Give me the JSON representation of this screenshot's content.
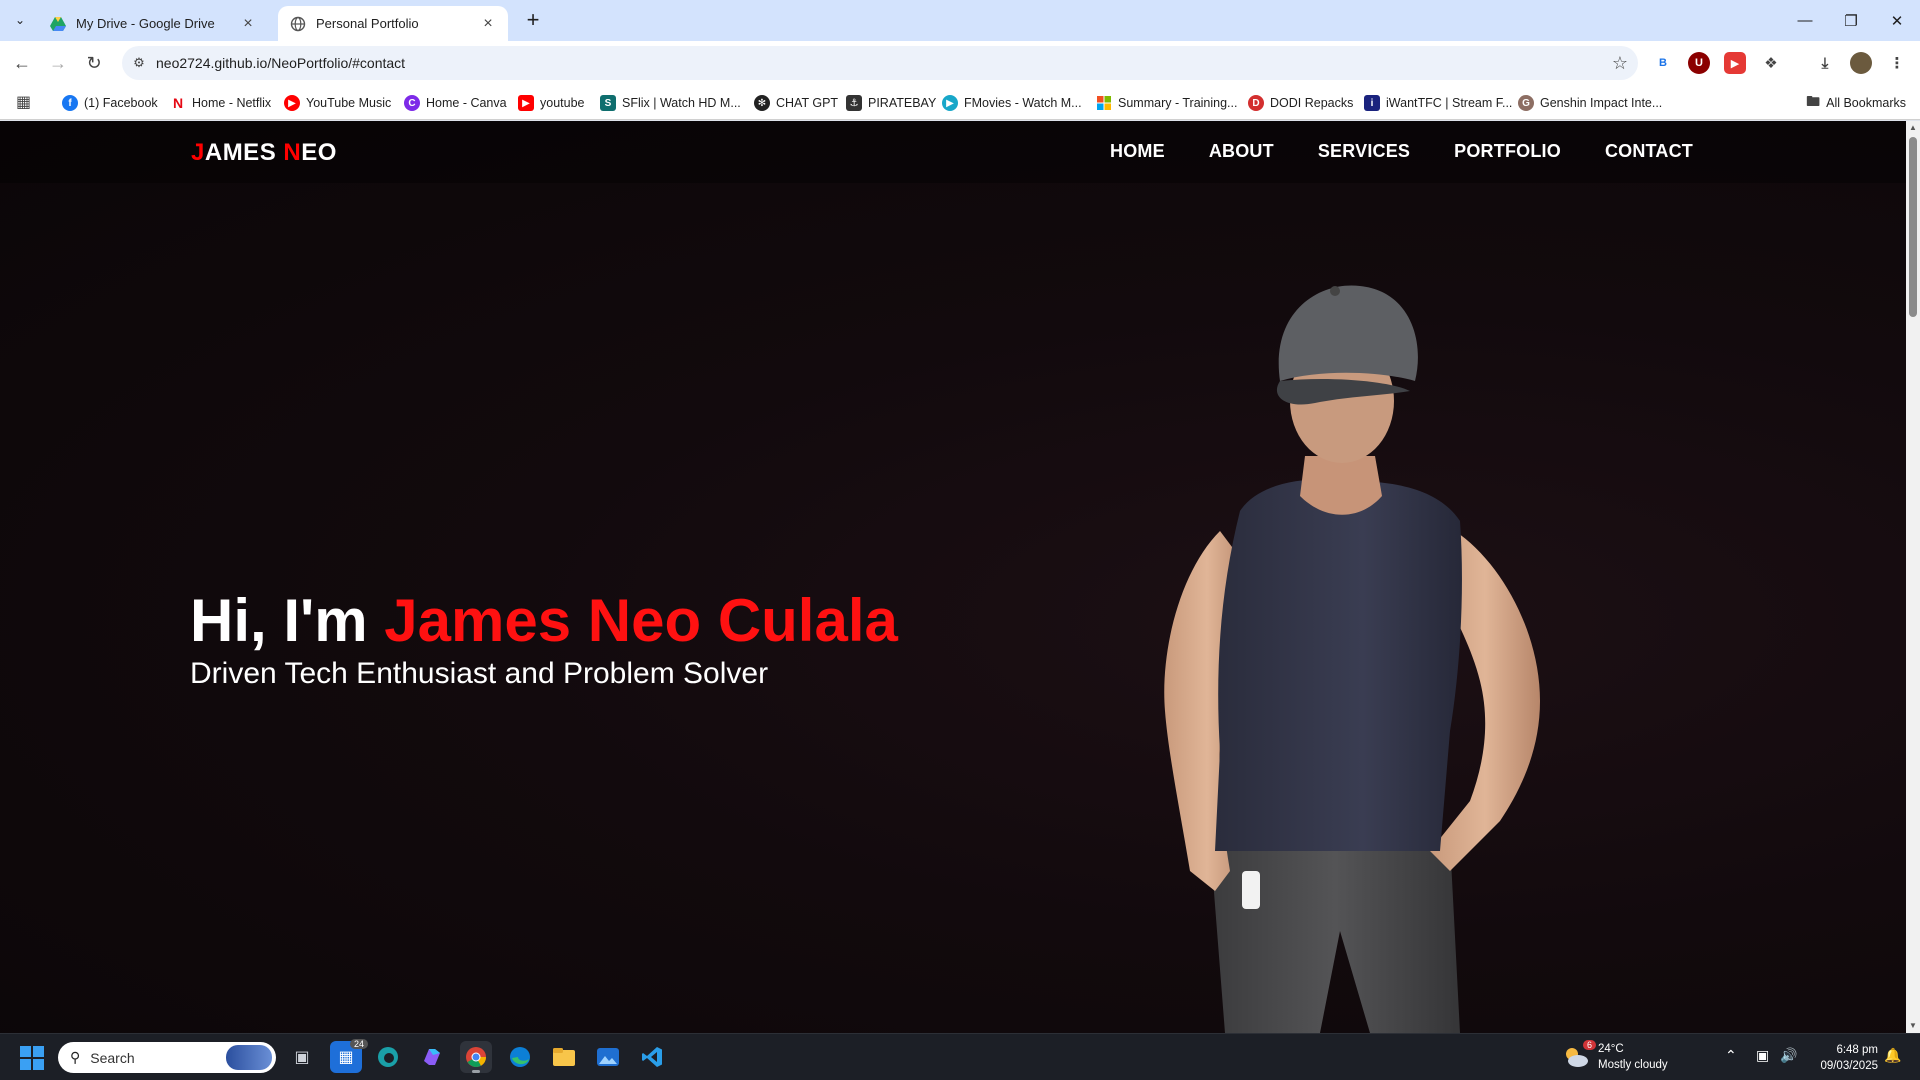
{
  "browser": {
    "tabs": [
      {
        "title": "My Drive - Google Drive",
        "active": false,
        "icon": "google-drive-icon"
      },
      {
        "title": "Personal Portfolio",
        "active": true,
        "icon": "globe-icon"
      }
    ],
    "url": "neo2724.github.io/NeoPortfolio/#contact",
    "bookmarks": [
      {
        "label": "(1) Facebook",
        "icon": "facebook-icon",
        "color": "#1877f2"
      },
      {
        "label": "Home - Netflix",
        "icon": "netflix-icon",
        "color": "#e50914"
      },
      {
        "label": "YouTube Music",
        "icon": "youtube-music-icon",
        "color": "#ff0000"
      },
      {
        "label": "Home - Canva",
        "icon": "canva-icon",
        "color": "#7d2ae8"
      },
      {
        "label": "youtube",
        "icon": "youtube-icon",
        "color": "#ff0000"
      },
      {
        "label": "SFlix | Watch HD M...",
        "icon": "sflix-icon",
        "color": "#0f6e6e"
      },
      {
        "label": "CHAT GPT",
        "icon": "chatgpt-icon",
        "color": "#222222"
      },
      {
        "label": "PIRATEBAY",
        "icon": "piratebay-icon",
        "color": "#333333"
      },
      {
        "label": "FMovies - Watch M...",
        "icon": "fmovies-icon",
        "color": "#18a7c9"
      },
      {
        "label": "Summary - Training...",
        "icon": "microsoft-icon",
        "color": "#f25022"
      },
      {
        "label": "DODI Repacks",
        "icon": "dodi-icon",
        "color": "#d32f2f"
      },
      {
        "label": "iWantTFC | Stream F...",
        "icon": "iwanttfc-icon",
        "color": "#1a237e"
      },
      {
        "label": "Genshin Impact Inte...",
        "icon": "genshin-icon",
        "color": "#8d6e63"
      }
    ],
    "all_bookmarks": "All Bookmarks"
  },
  "site": {
    "logo_first": "J",
    "logo_mid": "AMES ",
    "logo_n": "N",
    "logo_last": "EO",
    "nav": [
      "HOME",
      "ABOUT",
      "SERVICES",
      "PORTFOLIO",
      "CONTACT"
    ],
    "hero_greeting": "Hi, I'm ",
    "hero_name": "James Neo Culala",
    "hero_subtitle": "Driven Tech Enthusiast and Problem Solver",
    "accent_color": "#ff1111"
  },
  "taskbar": {
    "search_placeholder": "Search",
    "task_view_badge": "24",
    "weather_badge": "6",
    "temperature": "24°C",
    "weather": "Mostly cloudy",
    "time": "6:48 pm",
    "date": "09/03/2025"
  }
}
